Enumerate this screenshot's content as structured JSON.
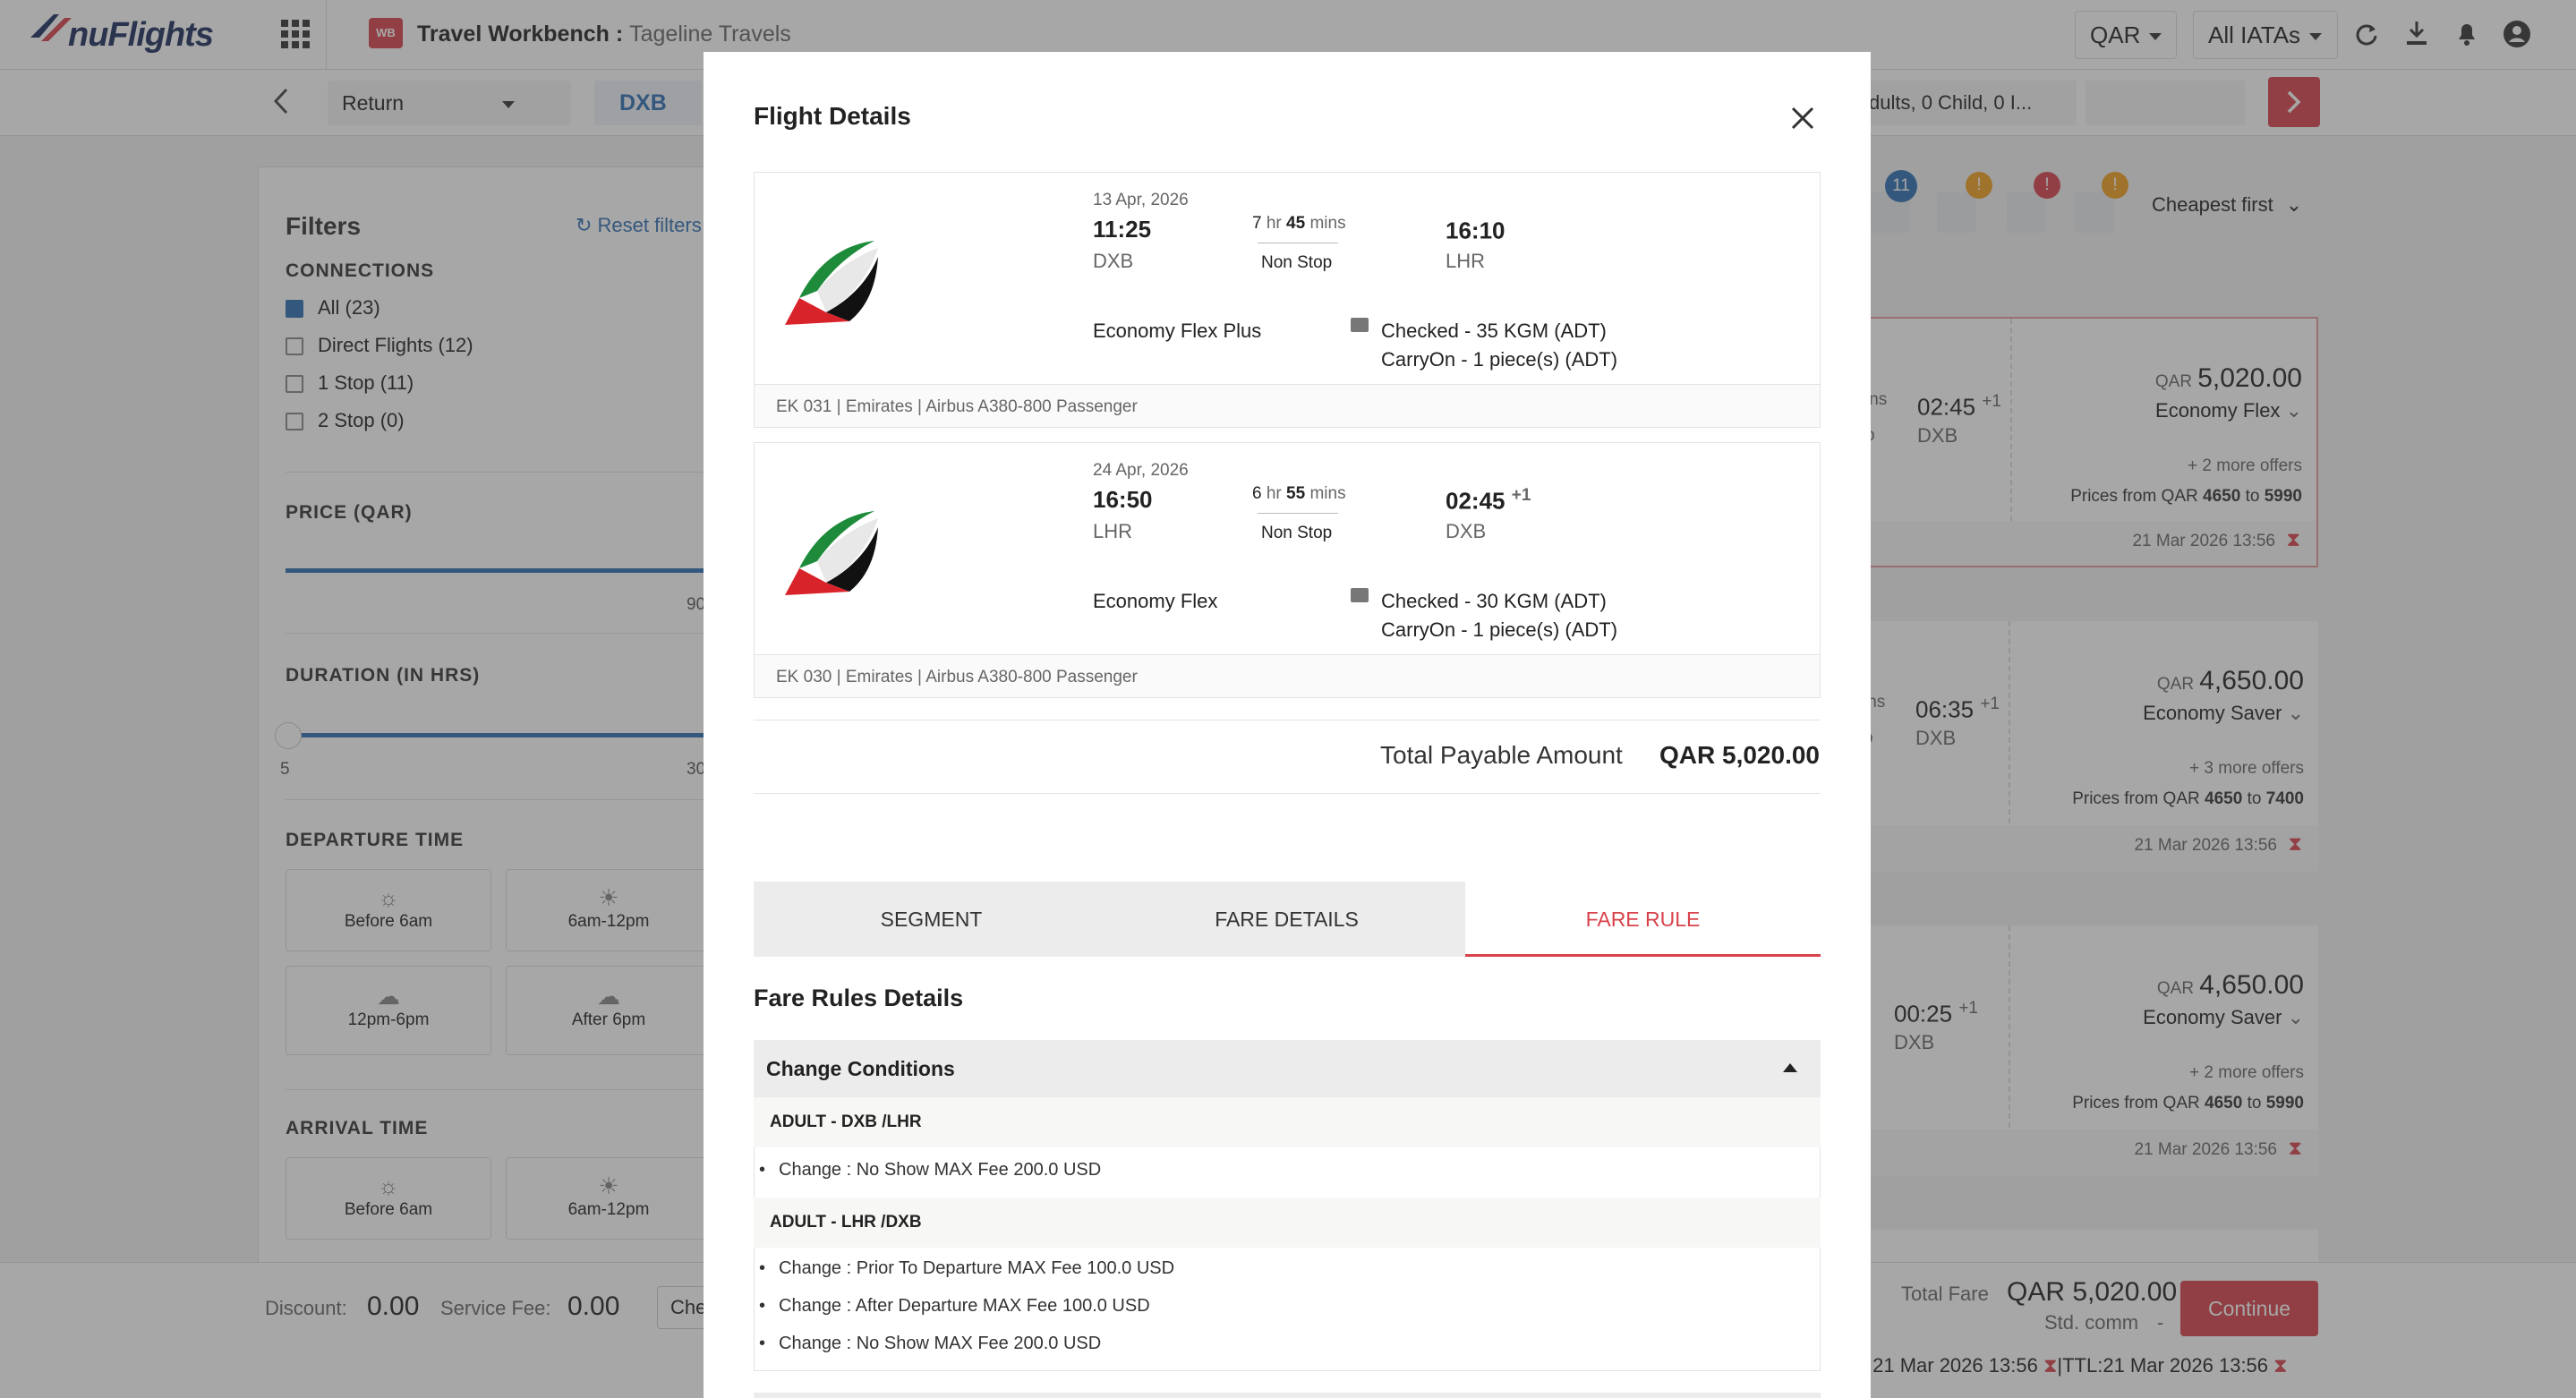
{
  "topbar": {
    "brand": "nuFlights",
    "workbench_label": "Travel Workbench :",
    "workbench_agency": "Tageline Travels",
    "currency": "QAR",
    "iata": "All IATAs",
    "wb_icon": "WB"
  },
  "searchbar": {
    "trip_type": "Return",
    "origin": "DXB",
    "passengers": "dults, 0 Child, 0 I..."
  },
  "filters": {
    "title": "Filters",
    "reset": "Reset filters",
    "connections_label": "CONNECTIONS",
    "connections": [
      {
        "label": "All (23)",
        "checked": true
      },
      {
        "label": "Direct Flights (12)",
        "checked": false
      },
      {
        "label": "1 Stop (11)",
        "checked": false
      },
      {
        "label": "2 Stop (0)",
        "checked": false
      }
    ],
    "price_label": "PRICE (QAR)",
    "price_max": "90",
    "duration_label": "DURATION (IN HRS)",
    "duration_min": "5",
    "duration_max": "30",
    "departure_label": "DEPARTURE TIME",
    "time_slots": [
      "Before 6am",
      "6am-12pm",
      "12pm-6pm",
      "After 6pm"
    ],
    "arrival_label": "ARRIVAL TIME",
    "arrival_slots": [
      "Before 6am",
      "6am-12pm"
    ]
  },
  "bottombar": {
    "discount_label": "Discount:",
    "discount": "0.00",
    "service_label": "Service Fee:",
    "service": "0.00",
    "check_stub": "Che",
    "total_label": "Total Fare",
    "total": "QAR 5,020.00",
    "std_comm": "Std. comm",
    "std_dash": "-",
    "continue": "Continue",
    "ttl": ":21 Mar 2026 13:56",
    "ttl2": "|TTL:21 Mar 2026 13:56"
  },
  "results": {
    "sort": "Cheapest first",
    "badge_count": "11",
    "cards": [
      {
        "mins": "ins",
        "stop": "p",
        "arr": "02:45",
        "plus": "+1",
        "airport": "DXB",
        "cur": "QAR",
        "price": "5,020.00",
        "fare": "Economy Flex",
        "more": "+ 2 more offers",
        "range_prefix": "Prices from QAR",
        "range_low": "4650",
        "range_to": "to",
        "range_high": "5990",
        "date": "21 Mar 2026 13:56"
      },
      {
        "mins": "ins",
        "stop": "p",
        "arr": "06:35",
        "plus": "+1",
        "airport": "DXB",
        "cur": "QAR",
        "price": "4,650.00",
        "fare": "Economy Saver",
        "more": "+ 3 more offers",
        "range_prefix": "Prices from QAR",
        "range_low": "4650",
        "range_to": "to",
        "range_high": "7400",
        "date": "21 Mar 2026 13:56"
      },
      {
        "mins": "",
        "stop": "",
        "arr": "00:25",
        "plus": "+1",
        "airport": "DXB",
        "cur": "QAR",
        "price": "4,650.00",
        "fare": "Economy Saver",
        "more": "+ 2 more offers",
        "range_prefix": "Prices from QAR",
        "range_low": "4650",
        "range_to": "to",
        "range_high": "5990",
        "date": "21 Mar 2026 13:56"
      }
    ]
  },
  "modal": {
    "title": "Flight Details",
    "segments": [
      {
        "date": "13 Apr, 2026",
        "dep_time": "11:25",
        "dep": "DXB",
        "dur_hr": "7",
        "dur_min": "45",
        "hr": "hr",
        "mins": "mins",
        "stops": "Non Stop",
        "arr_time": "16:10",
        "arr_plus": "",
        "arr": "LHR",
        "fare": "Economy Flex Plus",
        "checked": "Checked - 35 KGM (ADT)",
        "carry": "CarryOn - 1 piece(s) (ADT)",
        "footer": "EK 031 | Emirates | Airbus A380-800 Passenger"
      },
      {
        "date": "24 Apr, 2026",
        "dep_time": "16:50",
        "dep": "LHR",
        "dur_hr": "6",
        "dur_min": "55",
        "hr": "hr",
        "mins": "mins",
        "stops": "Non Stop",
        "arr_time": "02:45",
        "arr_plus": "+1",
        "arr": "DXB",
        "fare": "Economy Flex",
        "checked": "Checked - 30 KGM (ADT)",
        "carry": "CarryOn - 1 piece(s) (ADT)",
        "footer": "EK 030 | Emirates | Airbus A380-800 Passenger"
      }
    ],
    "total_label": "Total Payable Amount",
    "total": "QAR 5,020.00",
    "tabs": [
      "SEGMENT",
      "FARE DETAILS",
      "FARE RULE"
    ],
    "rules_title": "Fare Rules Details",
    "section": "Change Conditions",
    "groups": [
      {
        "title": "ADULT - DXB /LHR",
        "items": [
          "Change : No Show MAX Fee 200.0 USD"
        ]
      },
      {
        "title": "ADULT - LHR /DXB",
        "items": [
          "Change : Prior To Departure MAX Fee 100.0 USD",
          "Change : After Departure MAX Fee 100.0 USD",
          "Change : No Show MAX Fee 200.0 USD"
        ]
      }
    ]
  },
  "colors": {
    "accent": "#d8434b",
    "brand": "#1c2f5e",
    "link": "#2f6fb3"
  }
}
